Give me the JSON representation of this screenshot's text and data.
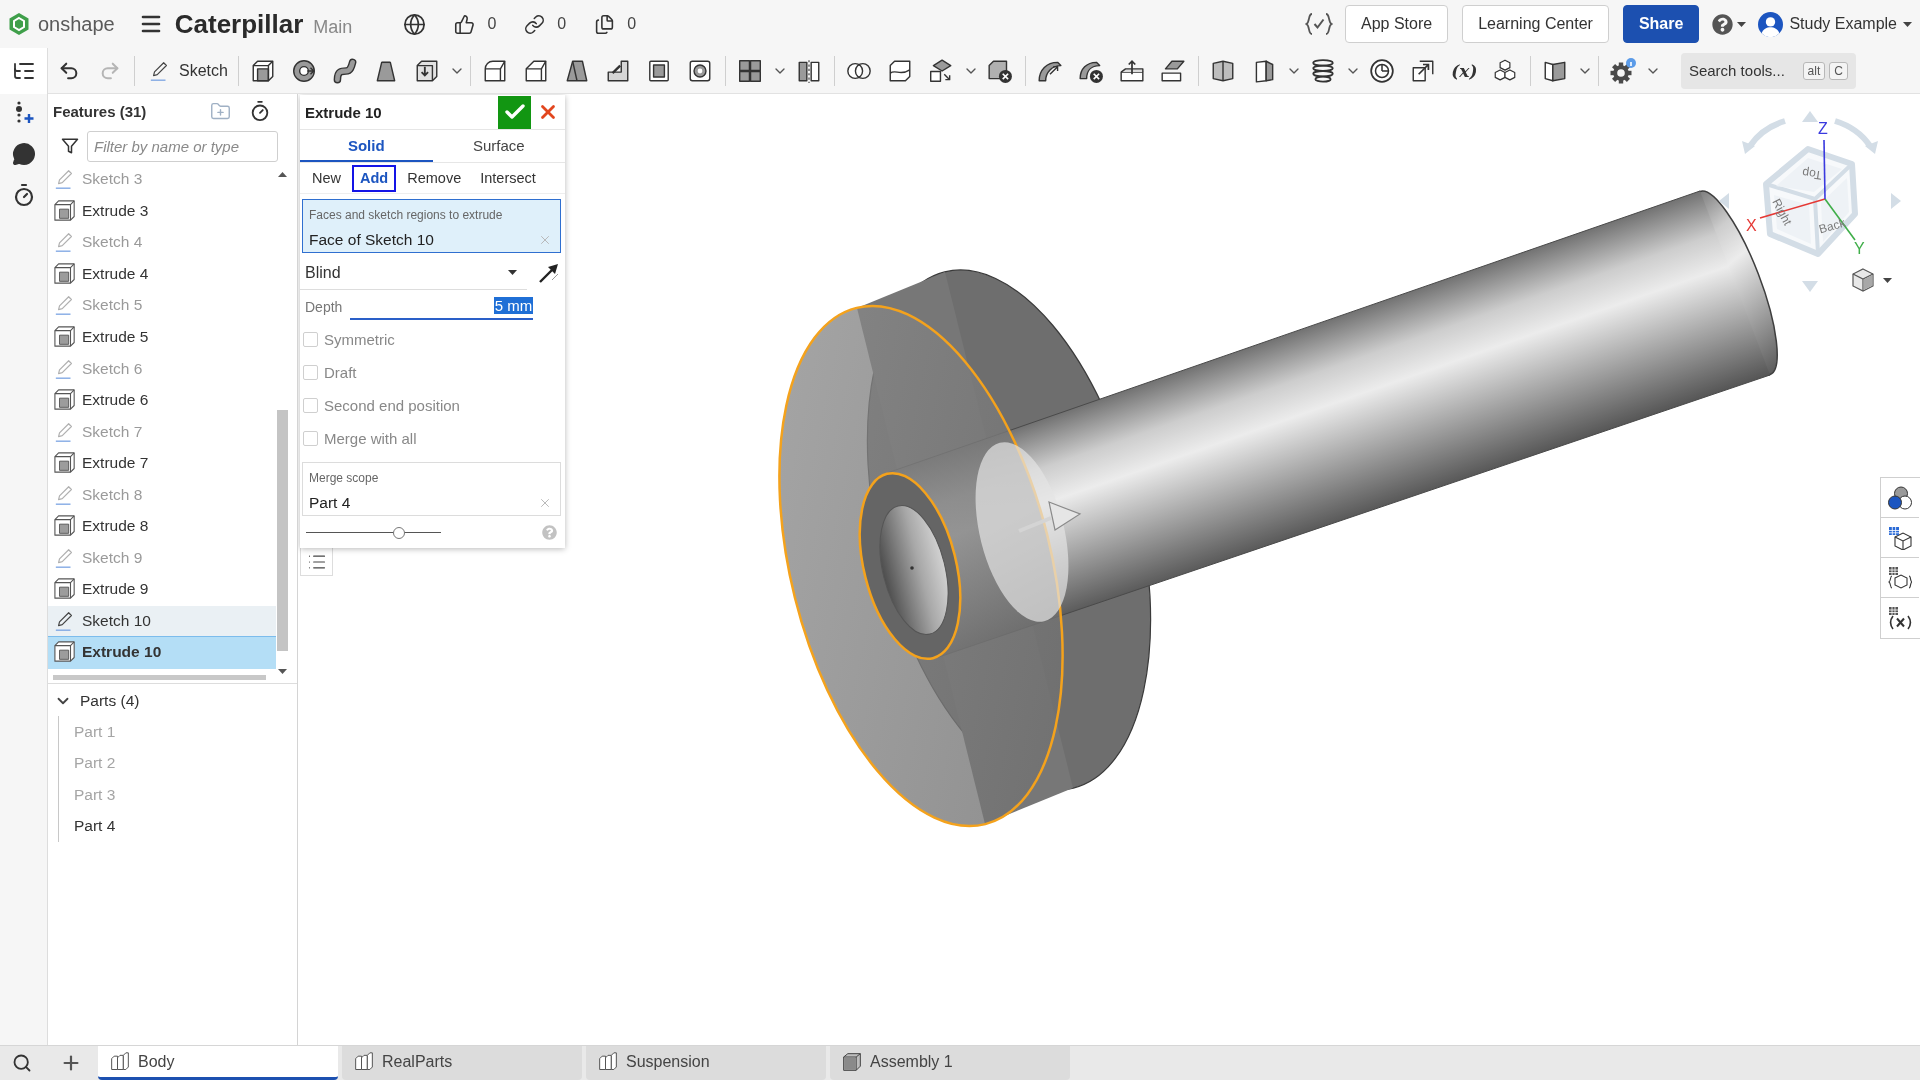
{
  "header": {
    "logo_text": "onshape",
    "document_title": "Caterpillar",
    "workspace": "Main",
    "counters": [
      {
        "kind": "likes",
        "count": "0"
      },
      {
        "kind": "links",
        "count": "0"
      },
      {
        "kind": "copies",
        "count": "0"
      }
    ],
    "buttons": [
      {
        "label": "App Store",
        "kind": "outline"
      },
      {
        "label": "Learning Center",
        "kind": "outline"
      },
      {
        "label": "Share",
        "kind": "primary"
      }
    ],
    "user_name": "Study Example"
  },
  "toolbar": {
    "undo": {
      "disabled": false
    },
    "redo": {
      "disabled": true
    },
    "sketch_label": "Sketch",
    "variable_glyph": "(x)",
    "search": {
      "placeholder": "Search tools...",
      "keys": [
        "alt",
        "C"
      ]
    }
  },
  "feature_panel": {
    "title": "Features (31)",
    "filter": {
      "placeholder": "Filter by name or type"
    },
    "features": [
      {
        "label": "Sketch 3",
        "kind": "sketch",
        "dimmed": true,
        "highlighted": false,
        "selected": false
      },
      {
        "label": "Extrude 3",
        "kind": "extrude",
        "dimmed": false,
        "highlighted": false,
        "selected": false
      },
      {
        "label": "Sketch 4",
        "kind": "sketch",
        "dimmed": true,
        "highlighted": false,
        "selected": false
      },
      {
        "label": "Extrude 4",
        "kind": "extrude",
        "dimmed": false,
        "highlighted": false,
        "selected": false
      },
      {
        "label": "Sketch 5",
        "kind": "sketch",
        "dimmed": true,
        "highlighted": false,
        "selected": false
      },
      {
        "label": "Extrude 5",
        "kind": "extrude",
        "dimmed": false,
        "highlighted": false,
        "selected": false
      },
      {
        "label": "Sketch 6",
        "kind": "sketch",
        "dimmed": true,
        "highlighted": false,
        "selected": false
      },
      {
        "label": "Extrude 6",
        "kind": "extrude",
        "dimmed": false,
        "highlighted": false,
        "selected": false
      },
      {
        "label": "Sketch 7",
        "kind": "sketch",
        "dimmed": true,
        "highlighted": false,
        "selected": false
      },
      {
        "label": "Extrude 7",
        "kind": "extrude",
        "dimmed": false,
        "highlighted": false,
        "selected": false
      },
      {
        "label": "Sketch 8",
        "kind": "sketch",
        "dimmed": true,
        "highlighted": false,
        "selected": false
      },
      {
        "label": "Extrude 8",
        "kind": "extrude",
        "dimmed": false,
        "highlighted": false,
        "selected": false
      },
      {
        "label": "Sketch 9",
        "kind": "sketch",
        "dimmed": true,
        "highlighted": false,
        "selected": false
      },
      {
        "label": "Extrude 9",
        "kind": "extrude",
        "dimmed": false,
        "highlighted": false,
        "selected": false
      },
      {
        "label": "Sketch 10",
        "kind": "sketch",
        "dimmed": false,
        "highlighted": true,
        "selected": false
      },
      {
        "label": "Extrude 10",
        "kind": "extrude",
        "dimmed": false,
        "highlighted": false,
        "selected": true
      }
    ],
    "parts": {
      "label": "Parts (4)",
      "expanded": true,
      "children": [
        {
          "label": "Part 1",
          "dimmed": true
        },
        {
          "label": "Part 2",
          "dimmed": true
        },
        {
          "label": "Part 3",
          "dimmed": true
        },
        {
          "label": "Part 4",
          "dimmed": false
        }
      ]
    }
  },
  "extrude_dialog": {
    "title": "Extrude 10",
    "body_types": [
      {
        "label": "Solid",
        "selected": true
      },
      {
        "label": "Surface",
        "selected": false
      }
    ],
    "operations": [
      {
        "label": "New",
        "selected": false
      },
      {
        "label": "Add",
        "selected": true
      },
      {
        "label": "Remove",
        "selected": false
      },
      {
        "label": "Intersect",
        "selected": false
      }
    ],
    "selection_field": {
      "label": "Faces and sketch regions to extrude",
      "value": "Face of Sketch 10"
    },
    "end_type": "Blind",
    "depth": {
      "label": "Depth",
      "value": "5 mm",
      "text_selected": true
    },
    "options": [
      {
        "label": "Symmetric",
        "checked": false
      },
      {
        "label": "Draft",
        "checked": false
      },
      {
        "label": "Second end position",
        "checked": false
      },
      {
        "label": "Merge with all",
        "checked": false
      }
    ],
    "merge_scope": {
      "label": "Merge scope",
      "value": "Part 4"
    },
    "slider": {
      "level": 0.69
    }
  },
  "view_cube": {
    "faces": [
      "Top",
      "Right",
      "Back"
    ],
    "axes": [
      {
        "label": "X",
        "color": "#e53935"
      },
      {
        "label": "Y",
        "color": "#3fae49"
      },
      {
        "label": "Z",
        "color": "#3a3adf"
      }
    ]
  },
  "tabs": [
    {
      "label": "Body",
      "kind": "part_studio",
      "selected": true
    },
    {
      "label": "RealParts",
      "kind": "part_studio",
      "selected": false
    },
    {
      "label": "Suspension",
      "kind": "part_studio",
      "selected": false
    },
    {
      "label": "Assembly 1",
      "kind": "assembly",
      "selected": false
    }
  ]
}
